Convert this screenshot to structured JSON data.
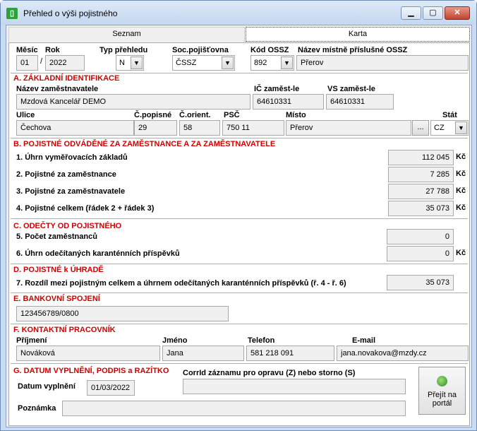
{
  "window": {
    "title": "Přehled o výši pojistného",
    "icon": "app-icon",
    "min": "▁",
    "max": "▢",
    "close": "✕"
  },
  "tabs": [
    {
      "label": "Seznam"
    },
    {
      "label": "Karta"
    }
  ],
  "header": {
    "mesic_label": "Měsíc",
    "mesic": "01",
    "slash": "/",
    "rok_label": "Rok",
    "rok": "2022",
    "typ_label": "Typ přehledu",
    "typ": "N",
    "soc_label": "Soc.pojišťovna",
    "soc": "ČSSZ",
    "kod_label": "Kód OSSZ",
    "kod": "892",
    "nazev_label": "Název místně příslušné OSSZ",
    "nazev": "Přerov"
  },
  "sectionA": {
    "title": "A. ZÁKLADNÍ IDENTIFIKACE",
    "employer_label": "Název zaměstnavatele",
    "employer": "Mzdová Kancelář DEMO",
    "ic_label": "IČ zaměst-le",
    "ic": "64610331",
    "vs_label": "VS zaměst-le",
    "vs": "64610331",
    "ulice_label": "Ulice",
    "ulice": "Čechova",
    "cp_label": "Č.popisné",
    "cp": "29",
    "co_label": "Č.orient.",
    "co": "58",
    "psc_label": "PSČ",
    "psc": "750 11",
    "misto_label": "Místo",
    "misto": "Přerov",
    "browse": "...",
    "stat_label": "Stát",
    "stat": "CZ"
  },
  "sectionB": {
    "title": "B. POJISTNÉ ODVÁDĚNÉ ZA ZAMĚSTNANCE A ZA ZAMĚSTNAVATELE",
    "rows": [
      {
        "label": "1. Úhrn vyměřovacích základů",
        "value": "112 045",
        "unit": "Kč"
      },
      {
        "label": "2. Pojistné za zaměstnance",
        "value": "7 285",
        "unit": "Kč"
      },
      {
        "label": "3. Pojistné za zaměstnavatele",
        "value": "27 788",
        "unit": "Kč"
      },
      {
        "label": "4. Pojistné celkem (řádek 2 + řádek 3)",
        "value": "35 073",
        "unit": "Kč"
      }
    ]
  },
  "sectionC": {
    "title": "C. ODEČTY OD POJISTNÉHO",
    "rows": [
      {
        "label": "5. Počet zaměstnanců",
        "value": "0",
        "unit": ""
      },
      {
        "label": "6. Úhrn odečítaných karanténních příspěvků",
        "value": "0",
        "unit": "Kč"
      }
    ]
  },
  "sectionD": {
    "title": "D. POJISTNÉ k ÚHRADĚ",
    "row_label": "7. Rozdíl mezi pojistným celkem a úhrnem odečítaných karanténních příspěvků (ř. 4 - ř. 6)",
    "value": "35 073"
  },
  "sectionE": {
    "title": "E. BANKOVNÍ SPOJENÍ",
    "account": "123456789/0800"
  },
  "sectionF": {
    "title": "F. KONTAKTNÍ PRACOVNÍK",
    "prijmeni_label": "Příjmení",
    "prijmeni": "Nováková",
    "jmeno_label": "Jméno",
    "jmeno": "Jana",
    "telefon_label": "Telefon",
    "telefon": "581 218 091",
    "email_label": "E-mail",
    "email": "jana.novakova@mzdy.cz"
  },
  "sectionG": {
    "title": "G. DATUM VYPLNĚNÍ, PODPIS a RAZÍTKO",
    "corrid_label": "CorrId záznamu pro opravu (Z) nebo storno (S)",
    "corrid": "",
    "datum_label": "Datum vyplnění",
    "datum": "01/03/2022",
    "poznamka_label": "Poznámka",
    "poznamka": "",
    "portal_line1": "Přejít na",
    "portal_line2": "portál"
  }
}
